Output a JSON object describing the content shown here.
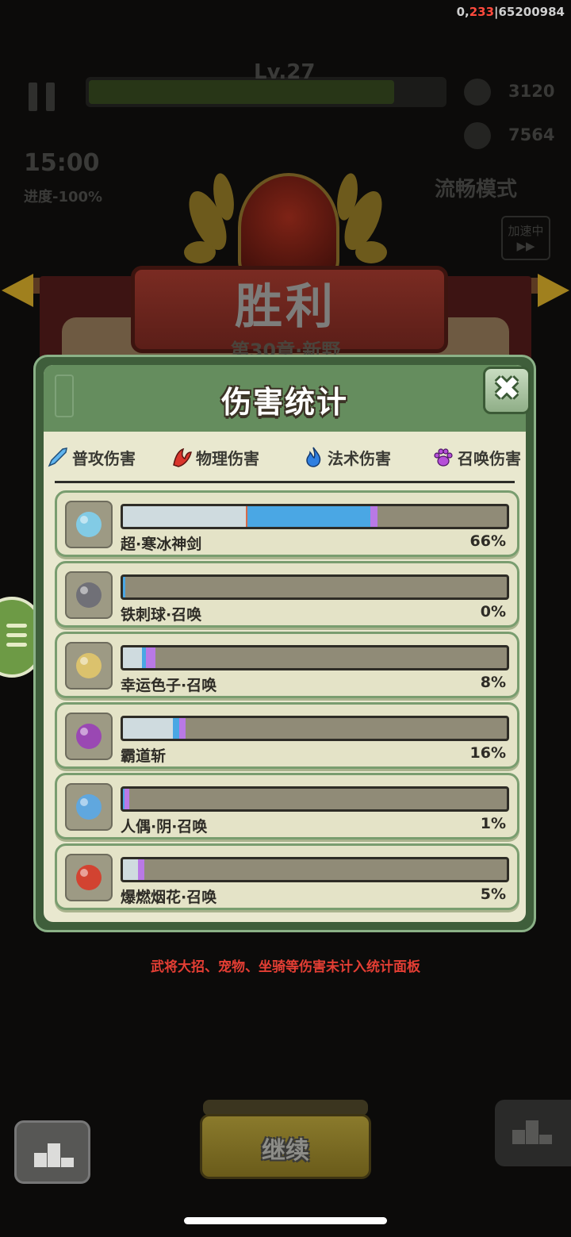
{
  "top_counter": {
    "left": "0,",
    "red": "233",
    "right": "|65200984"
  },
  "hud": {
    "level": "Lv.27",
    "stat1": "3120",
    "stat2": "7564",
    "time": "15:00",
    "progress": "进度-100%",
    "mode": "流畅模式",
    "speed": "加速中"
  },
  "victory": {
    "title": "胜利",
    "chapter": "第30章·新野"
  },
  "panel": {
    "title": "伤害统计",
    "close_label": "✖",
    "legend": [
      {
        "label": "普攻伤害",
        "icon": "sword-icon",
        "color": "#4aa7e4"
      },
      {
        "label": "物理伤害",
        "icon": "claw-icon",
        "color": "#d9352c"
      },
      {
        "label": "法术伤害",
        "icon": "flame-icon",
        "color": "#2f7fe0"
      },
      {
        "label": "召唤伤害",
        "icon": "paw-icon",
        "color": "#b64fd8"
      }
    ],
    "rows": [
      {
        "name": "超·寒冰神剑",
        "percent": "66%",
        "icon": "ice-sword-icon",
        "segments": {
          "white": 32,
          "blue": 32,
          "violet": 2
        }
      },
      {
        "name": "铁刺球·召唤",
        "percent": "0%",
        "icon": "spike-ball-icon",
        "segments": {
          "white": 0,
          "blue": 0.6,
          "violet": 0
        }
      },
      {
        "name": "幸运色子·召唤",
        "percent": "8%",
        "icon": "dice-icon",
        "segments": {
          "white": 5,
          "blue": 1,
          "violet": 2.5
        }
      },
      {
        "name": "霸道斩",
        "percent": "16%",
        "icon": "slash-icon",
        "segments": {
          "white": 13,
          "blue": 1.6,
          "violet": 1.8
        }
      },
      {
        "name": "人偶·阴·召唤",
        "percent": "1%",
        "icon": "doll-icon",
        "segments": {
          "white": 0,
          "blue": 0.4,
          "violet": 1.2
        }
      },
      {
        "name": "爆燃烟花·召唤",
        "percent": "5%",
        "icon": "firework-icon",
        "segments": {
          "white": 4,
          "blue": 0,
          "violet": 1.6
        }
      }
    ]
  },
  "note": "武将大招、宠物、坐骑等伤害未计入统计面板",
  "continue_label": "继续"
}
